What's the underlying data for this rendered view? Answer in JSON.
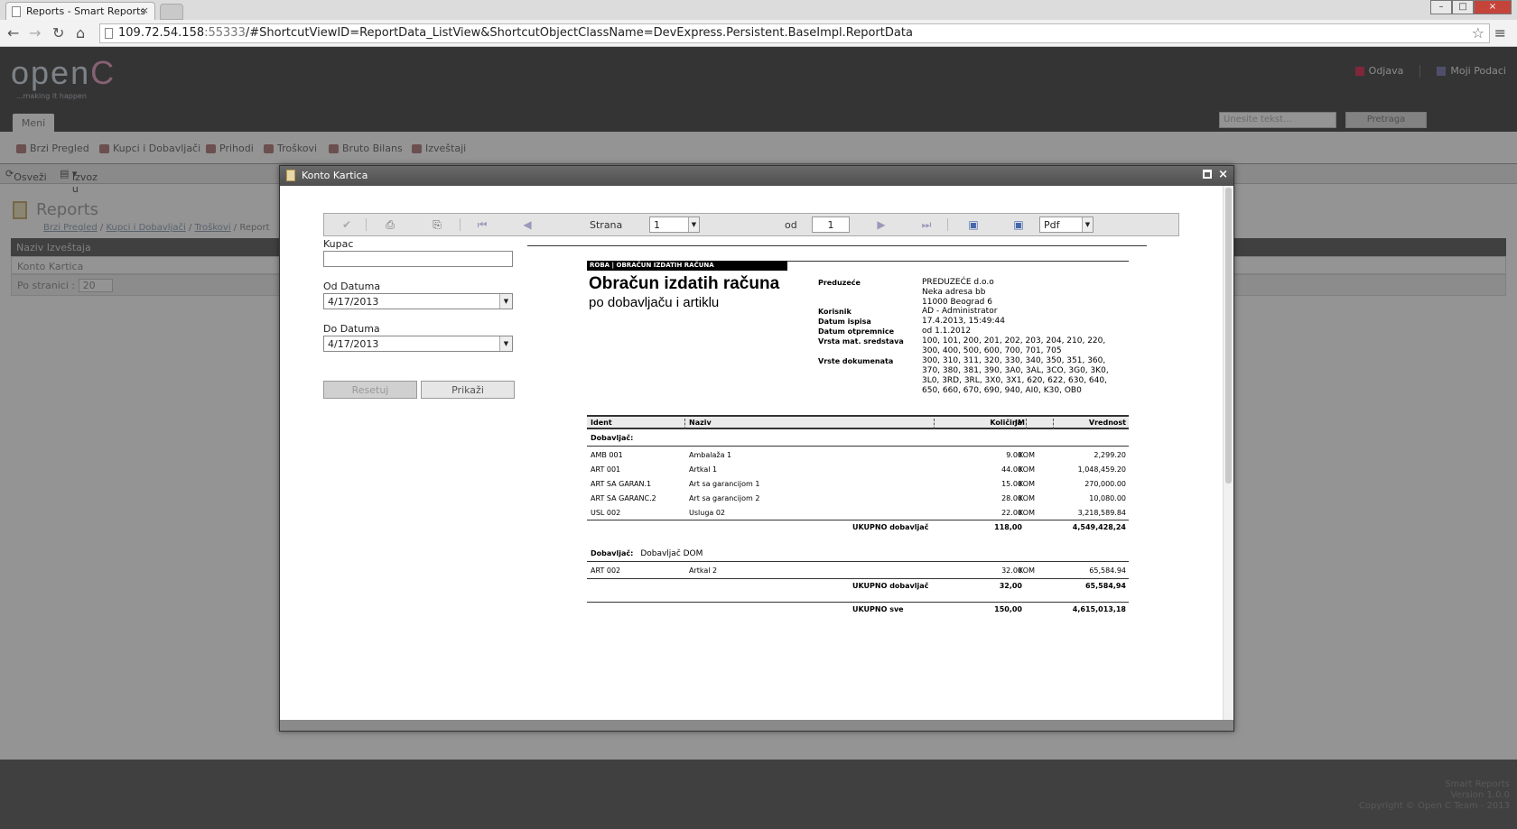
{
  "browser": {
    "tab_title": "Reports - Smart Reports",
    "tab_close": "×",
    "url_host": "109.72.54.158",
    "url_port": ":55333",
    "url_rest": "/#ShortcutViewID=ReportData_ListView&ShortcutObjectClassName=DevExpress.Persistent.BaseImpl.ReportData",
    "nav_back": "←",
    "nav_forward": "→",
    "nav_reload": "↻",
    "nav_home": "⌂",
    "bookmark_star": "☆",
    "menu_icon": "≡",
    "win_minimize": "–",
    "win_maximize": "□",
    "win_close": "×"
  },
  "app": {
    "logo_open": "open",
    "logo_c": "C",
    "tagline": "...making it happen",
    "logout": "Odjava",
    "my_data": "Moji Podaci",
    "search_placeholder": "Unesite tekst...",
    "search_button": "Pretraga",
    "main_tab": "Meni",
    "menu_items": [
      "Brzi Pregled",
      "Kupci i Dobavljači",
      "Prihodi",
      "Troškovi",
      "Bruto Bilans",
      "Izveštaji"
    ],
    "refresh": "Osveži",
    "export": "Izvoz u",
    "page_title": "Reports",
    "breadcrumb": [
      "Brzi Pregled",
      "Kupci i Dobavljači",
      "Troškovi",
      "Report"
    ],
    "grid_column": "Naziv Izveštaja",
    "grid_row": "Konto Kartica",
    "pager_label": "Po stranici :",
    "pager_value": "20",
    "footer_lines": [
      "Smart Reports",
      "Version 1.0.0",
      "Copyright © Open C Team - 2013"
    ]
  },
  "modal": {
    "title": "Konto Kartica",
    "close": "×",
    "toolbar": {
      "page_label": "Strana",
      "page_value": "1",
      "of_label": "od",
      "of_value": "1",
      "format_value": "Pdf"
    },
    "params": {
      "kupac_label": "Kupac",
      "kupac_value": "",
      "od_label": "Od Datuma",
      "od_value": "4/17/2013",
      "do_label": "Do Datuma",
      "do_value": "4/17/2013",
      "reset_button": "Resetuj",
      "show_button": "Prikaži"
    }
  },
  "report": {
    "strip": "ROBA | OBRAČUN IZDATIH RAČUNA",
    "title": "Obračun izdatih računa",
    "subtitle": "po dobavljaču i artiklu",
    "meta": [
      {
        "label": "Preduzeće",
        "value": "PREDUZEĆE d.o.o\nNeka adresa bb\n11000 Beograd 6"
      },
      {
        "label": "Korisnik",
        "value": "AD - Administrator"
      },
      {
        "label": "Datum ispisa",
        "value": "17.4.2013, 15:49:44"
      },
      {
        "label": "Datum otpremnice",
        "value": "od 1.1.2012"
      },
      {
        "label": "Vrsta mat. sredstava",
        "value": "100, 101, 200, 201, 202, 203, 204, 210, 220, 300, 400, 500, 600, 700, 701, 705"
      },
      {
        "label": "Vrste dokumenata",
        "value": "300, 310, 311, 320, 330, 340, 350, 351, 360, 370, 380, 381, 390, 3A0, 3AL, 3CO, 3G0, 3K0, 3L0, 3RD, 3RL, 3X0, 3X1, 620, 622, 630, 640, 650, 660, 670, 690, 940, AI0, K30, OB0"
      }
    ],
    "columns": {
      "ident": "Ident",
      "naziv": "Naziv",
      "kolicina": "Količina",
      "jm": "JM",
      "vrednost": "Vrednost"
    },
    "groups": [
      {
        "label": "Dobavljač:",
        "name": "",
        "rows": [
          {
            "ident": "AMB 001",
            "naziv": "Ambalaža 1",
            "kolicina": "9.00",
            "jm": "KOM",
            "vrednost": "2,299.20"
          },
          {
            "ident": "ART 001",
            "naziv": "Artkal 1",
            "kolicina": "44.00",
            "jm": "KOM",
            "vrednost": "1,048,459.20"
          },
          {
            "ident": "ART SA GARAN.1",
            "naziv": "Art sa garancijom 1",
            "kolicina": "15.00",
            "jm": "KOM",
            "vrednost": "270,000.00"
          },
          {
            "ident": "ART SA GARANC.2",
            "naziv": "Art sa garancijom 2",
            "kolicina": "28.00",
            "jm": "KOM",
            "vrednost": "10,080.00"
          },
          {
            "ident": "USL 002",
            "naziv": "Usluga 02",
            "kolicina": "22.00",
            "jm": "KOM",
            "vrednost": "3,218,589.84"
          }
        ],
        "total_label": "UKUPNO dobavljač",
        "total_kolicina": "118,00",
        "total_vrednost": "4,549,428,24"
      },
      {
        "label": "Dobavljač:",
        "name": "Dobavljač DOM",
        "rows": [
          {
            "ident": "ART 002",
            "naziv": "Artkal 2",
            "kolicina": "32.00",
            "jm": "KOM",
            "vrednost": "65,584.94"
          }
        ],
        "total_label": "UKUPNO dobavljač",
        "total_kolicina": "32,00",
        "total_vrednost": "65,584,94"
      }
    ],
    "grand_total_label": "UKUPNO sve",
    "grand_total_kolicina": "150,00",
    "grand_total_vrednost": "4,615,013,18"
  }
}
